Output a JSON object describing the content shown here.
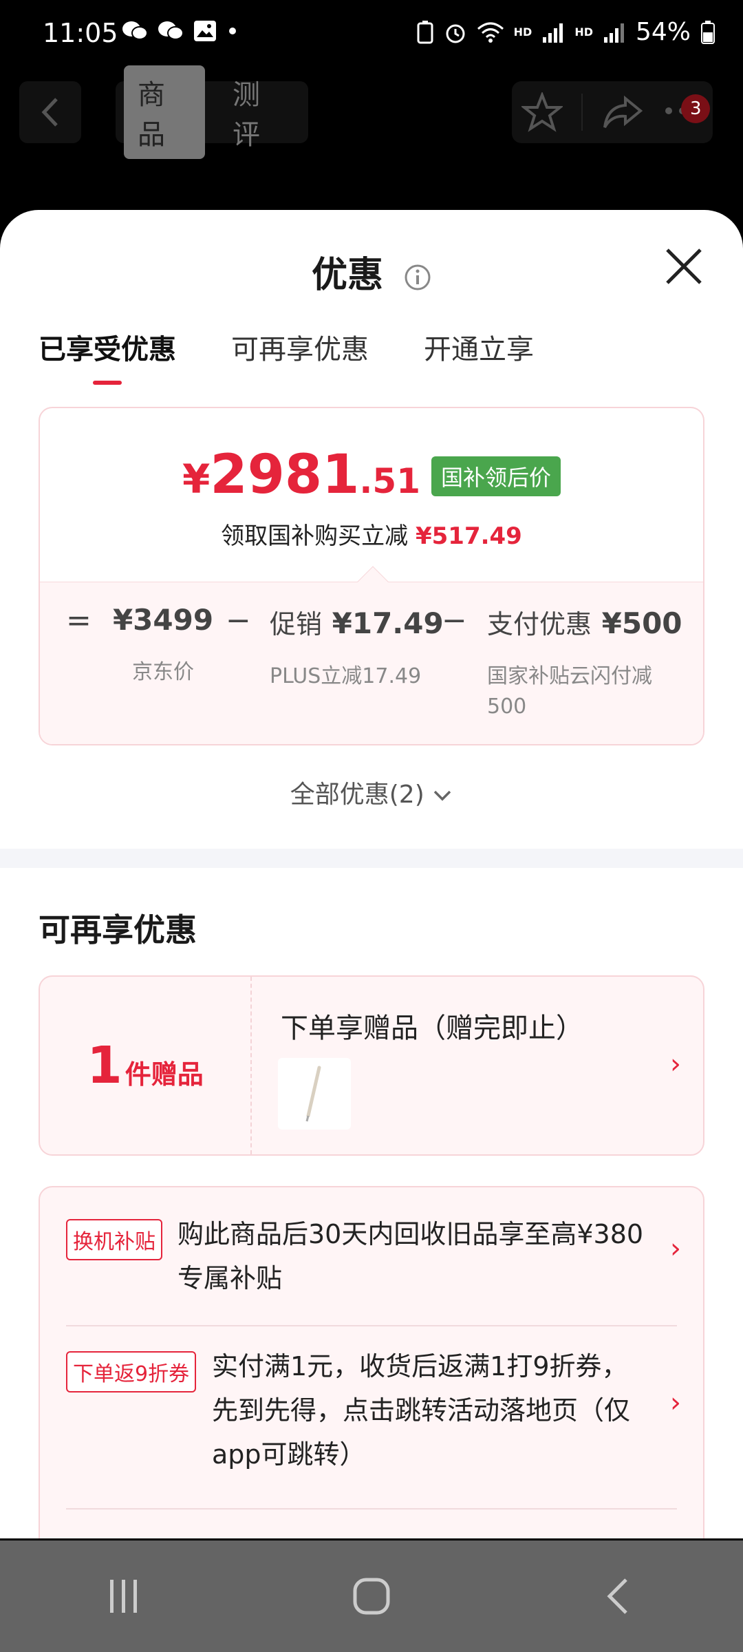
{
  "status_bar": {
    "time": "11:05",
    "battery": "54%",
    "hd1": "HD",
    "hd2": "HD",
    "net": "4G"
  },
  "top_nav": {
    "tabs": [
      "商品",
      "测评"
    ],
    "active_tab": 0,
    "badge_count": "3"
  },
  "sheet": {
    "title": "优惠",
    "tabs": [
      "已享受优惠",
      "可再享优惠",
      "开通立享"
    ],
    "price": {
      "currency": "¥",
      "integer": "2981",
      "decimal": ".51",
      "tag": "国补领后价",
      "sub_text": "领取国补购买立减",
      "sub_amount": "¥517.49"
    },
    "breakdown": {
      "eq": "=",
      "minus": "−",
      "items": [
        {
          "label": "",
          "value": "¥3499",
          "caption": "京东价"
        },
        {
          "label": "促销",
          "value": "¥17.49",
          "caption": "PLUS立减17.49"
        },
        {
          "label": "支付优惠",
          "value": "¥500",
          "caption": "国家补贴云闪付减500"
        }
      ]
    },
    "all_offers": "全部优惠(2)",
    "section_title": "可再享优惠",
    "gift": {
      "count": "1",
      "unit": "件赠品",
      "title": "下单享赠品（赠完即止）"
    },
    "coupons": [
      {
        "tag": "换机补贴",
        "text": "购此商品后30天内回收旧品享至高¥380专属补贴"
      },
      {
        "tag": "下单返9折券",
        "text": "实付满1元，收货后返满1打9折券，先到先得，点击跳转活动落地页（仅app可跳转）"
      }
    ]
  },
  "colors": {
    "accent_red": "#e5243b",
    "tag_green": "#4aa64d",
    "card_bg": "#fff5f6",
    "navbar_bg": "#646464"
  }
}
